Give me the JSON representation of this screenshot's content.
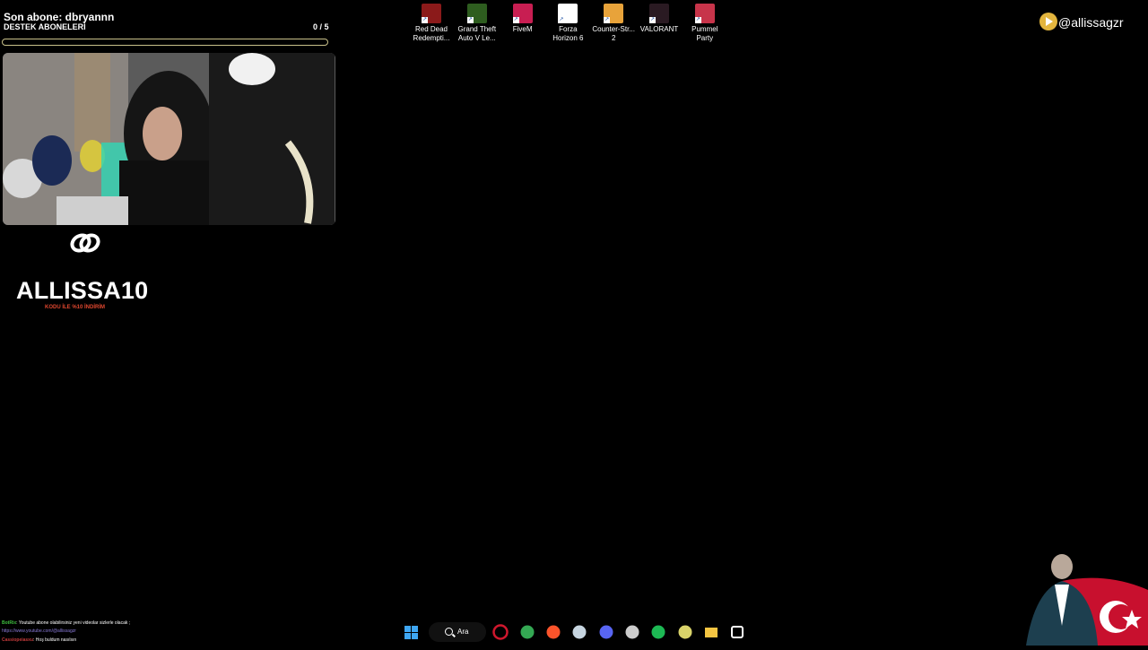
{
  "overlay": {
    "latest_sub": "Son abone: dbryannn",
    "goal_label": "DESTEK ABONELERİ",
    "goal_count": "0 / 5",
    "goal_progress": 0.0,
    "goal_color": "#c9c18a"
  },
  "promo": {
    "code": "ALLISSA10",
    "subtitle": "KODU İLE %10 İNDİRİM",
    "accent": "#e0472f"
  },
  "desktop_icons": [
    {
      "label": "Red Dead Redempti...",
      "icon": "red-dead-icon",
      "color": "#8b1a1a"
    },
    {
      "label": "Grand Theft Auto V Le...",
      "icon": "gta-v-icon",
      "color": "#2e5d1f"
    },
    {
      "label": "FiveM",
      "icon": "fivem-icon",
      "color": "#c81e52"
    },
    {
      "label": "Forza Horizon 6",
      "icon": "forza-icon",
      "color": "#ffffff"
    },
    {
      "label": "Counter-Str... 2",
      "icon": "counter-strike-icon",
      "color": "#e8a33a"
    },
    {
      "label": "VALORANT",
      "icon": "valorant-icon",
      "color": "#2a1a22"
    },
    {
      "label": "Pummel Party",
      "icon": "pummel-party-icon",
      "color": "#c7344a"
    }
  ],
  "social": {
    "handle": "@allissagzr",
    "icon": "youtube-play-icon"
  },
  "chat": [
    {
      "user": "BotRix",
      "text": ": Youtube abone olabilirsiniz yeni videolar sizlerle olacak ;",
      "user_color": "#3fbf3f"
    },
    {
      "user": "",
      "text": "https://www.youtube.com/@allissagzr",
      "user_color": "#8a7bd8"
    },
    {
      "user": "Cassiopeiasxu",
      "text": ": Hoş buldum nasılsın",
      "user_color": "#c43b3b"
    }
  ],
  "taskbar": {
    "search_label": "Ara",
    "apps": [
      {
        "name": "windows-start-icon",
        "color": "#3ea6f2"
      },
      {
        "name": "opera-icon",
        "color": "#d0172d"
      },
      {
        "name": "chrome-icon",
        "color": "#34a853"
      },
      {
        "name": "brave-icon",
        "color": "#fb542b"
      },
      {
        "name": "steam-icon",
        "color": "#c7d5e0"
      },
      {
        "name": "discord-icon",
        "color": "#5865f2"
      },
      {
        "name": "obs-icon",
        "color": "#cccccc"
      },
      {
        "name": "spotify-icon",
        "color": "#1db954"
      },
      {
        "name": "app-icon",
        "color": "#d9d36a"
      },
      {
        "name": "file-explorer-icon",
        "color": "#f5c542"
      },
      {
        "name": "capcut-icon",
        "color": "#ffffff"
      }
    ]
  }
}
